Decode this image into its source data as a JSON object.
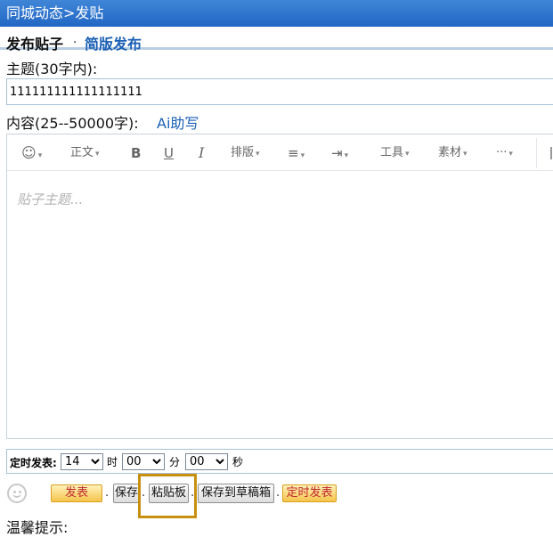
{
  "header": {
    "title": "同城动态>发贴"
  },
  "mode": {
    "active": "发布贴子",
    "separator": ".",
    "simple_link": "简版发布"
  },
  "subject": {
    "label": "主题(30字内):",
    "value": "111111111111111111"
  },
  "content": {
    "label": "内容(25--50000字):",
    "ai_link": "Ai助写"
  },
  "toolbar": {
    "emoji": "☺",
    "paragraph": "正文",
    "bold": "B",
    "underline": "U",
    "italic": "I",
    "layout": "排版",
    "align": "≡",
    "indent": "⇥",
    "tools": "工具",
    "material": "素材",
    "more": "···",
    "caret": "▾"
  },
  "editor": {
    "placeholder": "贴子主题..."
  },
  "timer": {
    "label": "定时发表:",
    "hour": "14",
    "hour_unit": "时",
    "minute": "00",
    "minute_unit": "分",
    "second": "00",
    "second_unit": "秒"
  },
  "actions": {
    "publish": "发表",
    "save": "保存",
    "clipboard": "粘贴板",
    "save_draft": "保存到草稿箱",
    "scheduled_publish": "定时发表",
    "separator": "."
  },
  "tips": {
    "label": "温馨提示:"
  },
  "colors": {
    "header_blue": "#2266c3",
    "link_blue": "#1a5fb4",
    "button_gold": "#f5c44c",
    "highlight": "#c8900f"
  }
}
